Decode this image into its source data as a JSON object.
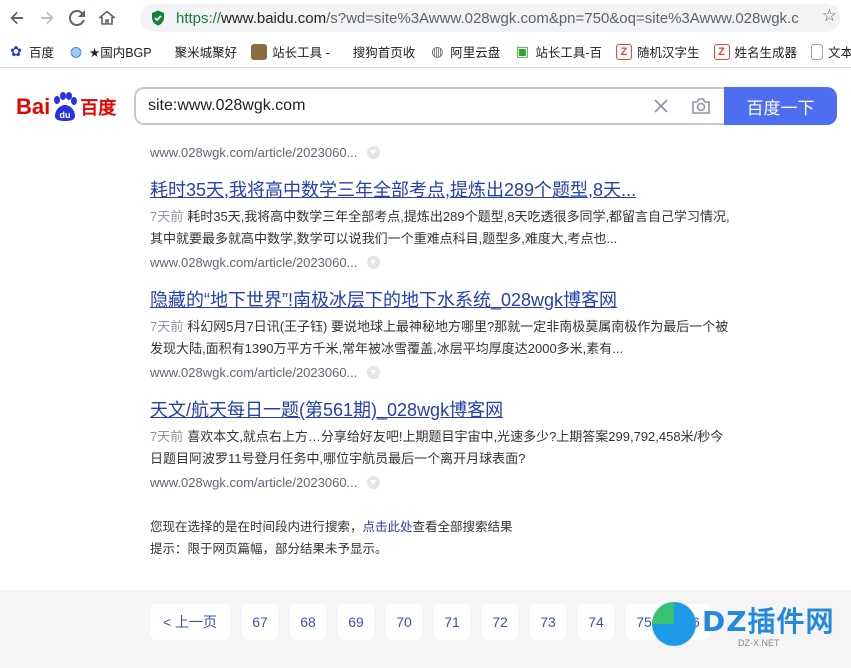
{
  "browser": {
    "url_https": "https://",
    "url_host": "www.baidu.com",
    "url_rest": "/s?wd=site%3Awww.028wgk.com&pn=750&oq=site%3Awww.028wgk.c",
    "bookmarks": [
      {
        "label": "百度",
        "icon": "baidu-paw-icon",
        "color": "#2932e1"
      },
      {
        "label": "★国内BGP",
        "icon": "globe-icon",
        "color": "#1a73e8"
      },
      {
        "label": "聚米城聚好",
        "icon": "blank-page-icon",
        "color": "#ffffff"
      },
      {
        "label": "站长工具 -",
        "icon": "cat-avatar-icon",
        "color": "#8a6d3b"
      },
      {
        "label": "搜狗首页收",
        "icon": "blank-page-icon",
        "color": "#ffffff"
      },
      {
        "label": "阿里云盘",
        "icon": "globe-icon",
        "color": "#5f6368"
      },
      {
        "label": "站长工具-百",
        "icon": "chinaz-icon",
        "color": "#2aa52a"
      },
      {
        "label": "随机汉字生",
        "icon": "z-logo-icon",
        "color": "#e8453c"
      },
      {
        "label": "姓名生成器",
        "icon": "z-logo-icon",
        "color": "#e8453c"
      },
      {
        "label": "文本",
        "icon": "document-icon",
        "color": "#9aa0a6"
      }
    ]
  },
  "search": {
    "logo_left": "Bai",
    "logo_paw": "du",
    "logo_right": "百度",
    "query": "site:www.028wgk.com",
    "button": "百度一下"
  },
  "results": {
    "first_url": "www.028wgk.com/article/2023060...",
    "items": [
      {
        "title": "耗时35天,我将高中数学三年全部考点,提炼出289个题型,8天...",
        "age": "7天前",
        "abstract": "耗时35天,我将高中数学三年全部考点,提炼出289个题型,8天吃透很多同学,都留言自己学习情况,其中就要最多就高中数学,数学可以说我们一个重难点科目,题型多,难度大,考点也...",
        "url": "www.028wgk.com/article/2023060..."
      },
      {
        "title": "隐藏的“地下世界”!南极冰层下的地下水系统_028wgk博客网",
        "age": "7天前",
        "abstract": "科幻网5月7日讯(王子钰) 要说地球上最神秘地方哪里?那就一定非南极莫属南极作为最后一个被发现大陆,面积有1390万平方千米,常年被冰雪覆盖,冰层平均厚度达2000多米,素有...",
        "url": "www.028wgk.com/article/2023060..."
      },
      {
        "title": "天文/航天每日一题(第561期)_028wgk博客网",
        "age": "7天前",
        "abstract": "喜欢本文,就点右上方…分享给好友吧!上期题目宇宙中,光速多少?上期答案299,792,458米/秒今日题目阿波罗11号登月任务中,哪位宇航员最后一个离开月球表面?",
        "url": "www.028wgk.com/article/2023060..."
      }
    ]
  },
  "notice": {
    "line1_pre": "您现在选择的是在时间段内进行搜索，",
    "line1_link": "点击此处",
    "line1_post": "查看全部搜索结果",
    "line2": "提示：限于网页篇幅，部分结果未予显示。"
  },
  "pager": {
    "prev": "< 上一页",
    "pages": [
      "67",
      "68",
      "69",
      "70",
      "71",
      "72",
      "73",
      "74",
      "75",
      "76"
    ]
  },
  "watermark": {
    "text": "DZ插件网",
    "sub": "DZ-X.NET"
  }
}
